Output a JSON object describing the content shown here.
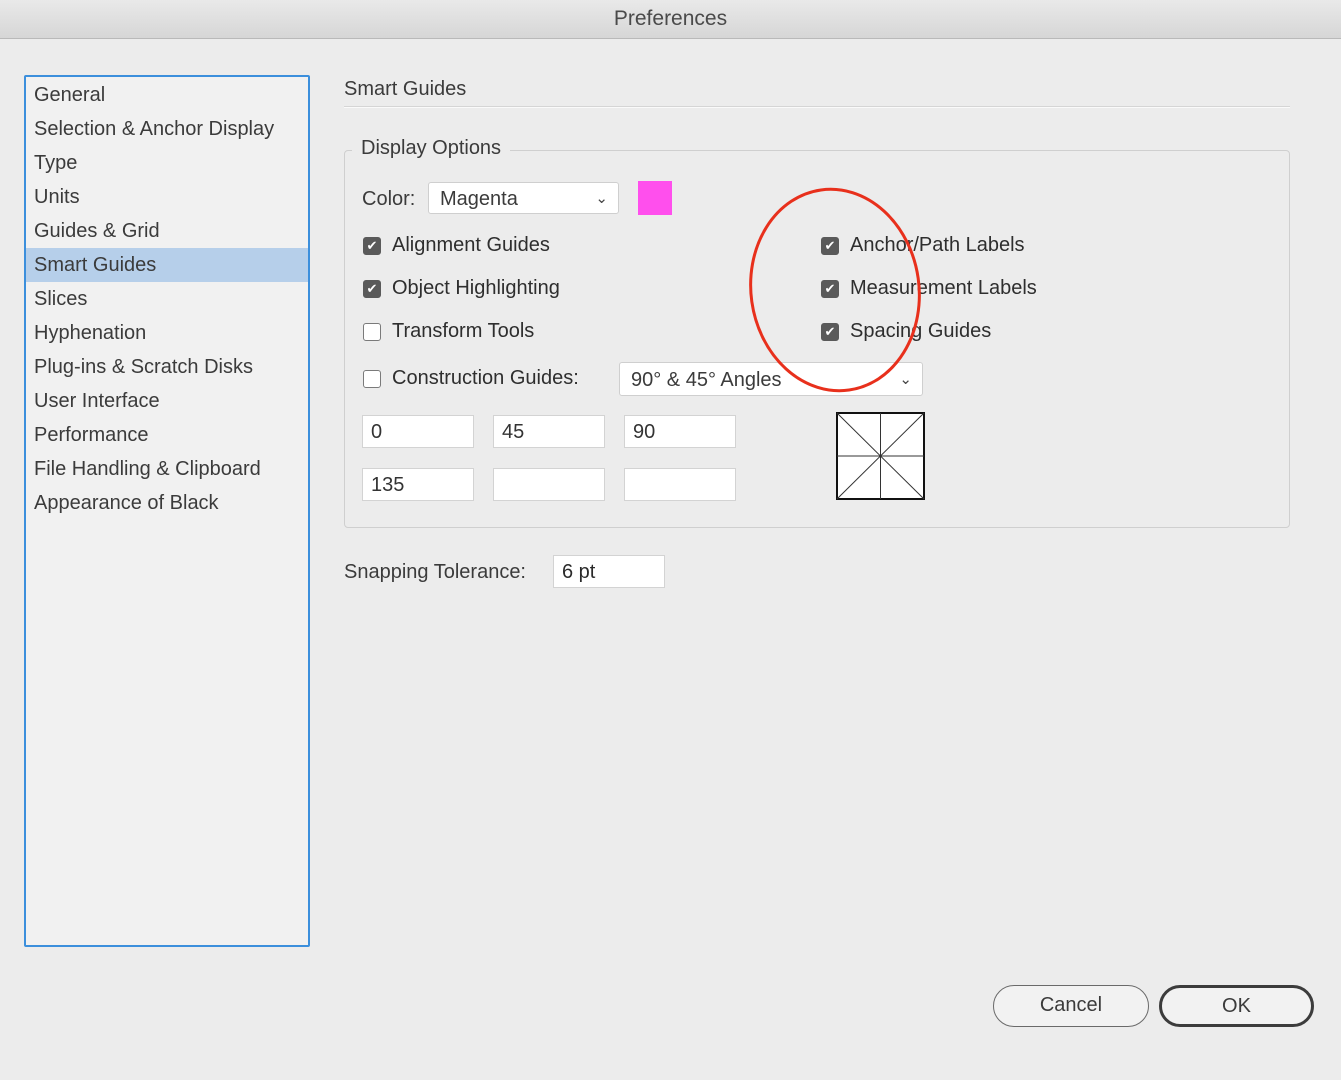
{
  "window": {
    "title": "Preferences"
  },
  "sidebar": {
    "items": [
      {
        "label": "General"
      },
      {
        "label": "Selection & Anchor Display"
      },
      {
        "label": "Type"
      },
      {
        "label": "Units"
      },
      {
        "label": "Guides & Grid"
      },
      {
        "label": "Smart Guides",
        "selected": true
      },
      {
        "label": "Slices"
      },
      {
        "label": "Hyphenation"
      },
      {
        "label": "Plug-ins & Scratch Disks"
      },
      {
        "label": "User Interface"
      },
      {
        "label": "Performance"
      },
      {
        "label": "File Handling & Clipboard"
      },
      {
        "label": "Appearance of Black"
      }
    ]
  },
  "panel": {
    "title": "Smart Guides",
    "display_options": {
      "legend": "Display Options",
      "color_label": "Color:",
      "color_value": "Magenta",
      "swatch_color": "#ff4fed",
      "checks": {
        "alignment_guides": {
          "label": "Alignment Guides",
          "checked": true
        },
        "object_highlighting": {
          "label": "Object Highlighting",
          "checked": true
        },
        "transform_tools": {
          "label": "Transform Tools",
          "checked": false
        },
        "anchor_path_labels": {
          "label": "Anchor/Path Labels",
          "checked": true
        },
        "measurement_labels": {
          "label": "Measurement Labels",
          "checked": true
        },
        "spacing_guides": {
          "label": "Spacing Guides",
          "checked": true
        },
        "construction_guides": {
          "label": "Construction Guides:",
          "checked": false
        }
      },
      "construction_angles_value": "90° & 45° Angles",
      "angles": [
        "0",
        "45",
        "90",
        "135",
        "",
        ""
      ]
    },
    "snapping": {
      "label": "Snapping Tolerance:",
      "value": "6 pt"
    }
  },
  "buttons": {
    "cancel": "Cancel",
    "ok": "OK"
  },
  "annotation": {
    "color": "#e8301c"
  }
}
